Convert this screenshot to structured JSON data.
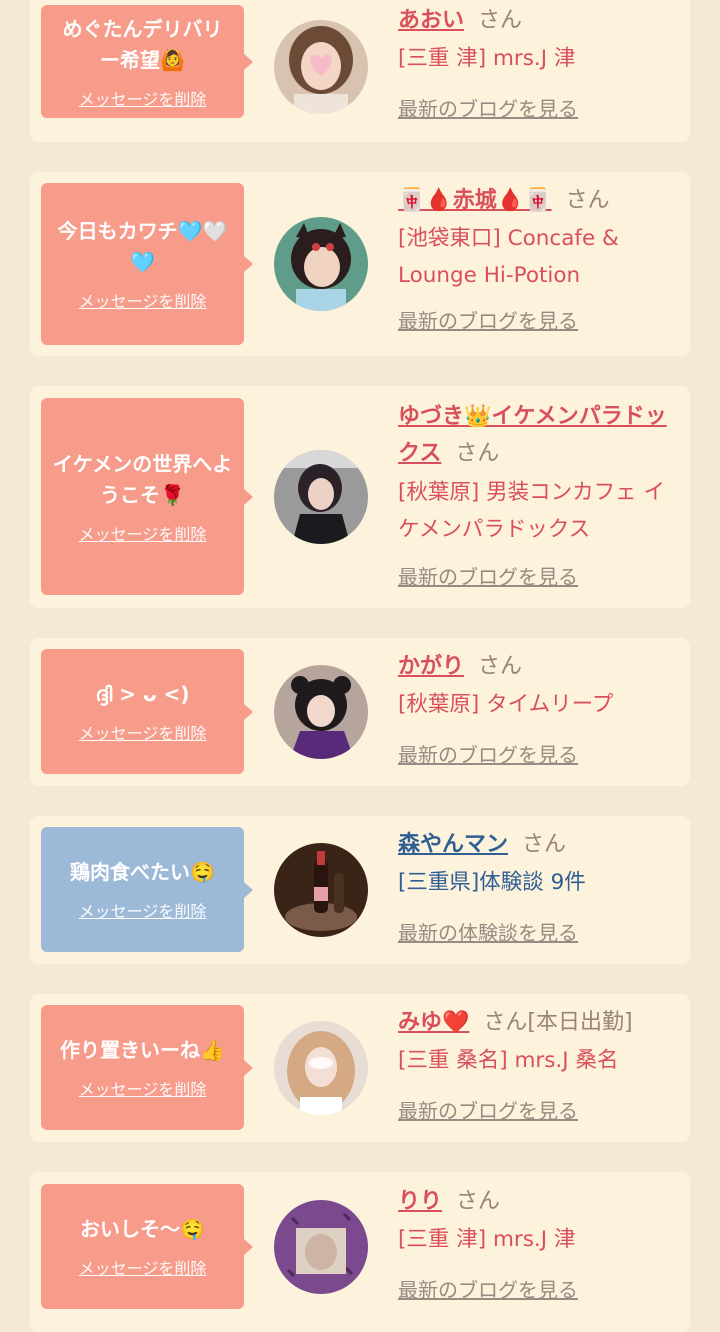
{
  "cards": [
    {
      "bubble_color": "#f79b8a",
      "message": "めぐたんデリバリー希望🙆",
      "delete_label": "メッセージを削除",
      "name": "あおい",
      "suffix": "さん",
      "shop": "[三重 津] mrs.J 津",
      "link": "最新のブログを見る"
    },
    {
      "bubble_color": "#f79b8a",
      "message": "今日もカワチ🩵🤍🩵",
      "delete_label": "メッセージを削除",
      "name": "🀄🩸赤城🩸🀄",
      "suffix": "さん",
      "shop": "[池袋東口] Concafe & Lounge Hi-Potion",
      "link": "最新のブログを見る"
    },
    {
      "bubble_color": "#f79b8a",
      "message": "イケメンの世界へようこそ🌹",
      "delete_label": "メッセージを削除",
      "name": "ゆづき👑イケメンパラドックス",
      "suffix": "さん",
      "shop": "[秋葉原] 男装コンカフェ イケメンパラドックス",
      "link": "最新のブログを見る"
    },
    {
      "bubble_color": "#f79b8a",
      "message": "ദ്ദി > ᴗ <)",
      "delete_label": "メッセージを削除",
      "name": "かがり",
      "suffix": "さん",
      "shop": "[秋葉原] タイムリープ",
      "link": "最新のブログを見る"
    },
    {
      "bubble_color": "#9db9d8",
      "message": "鶏肉食べたい🤤",
      "delete_label": "メッセージを削除",
      "name": "森やんマン",
      "suffix": "さん",
      "shop": "[三重県]体験談 9件",
      "link": "最新の体験談を見る"
    },
    {
      "bubble_color": "#f79b8a",
      "message": "作り置きいーね👍",
      "delete_label": "メッセージを削除",
      "name": "みゆ❤️",
      "suffix": "さん[本日出勤]",
      "shop": "[三重 桑名] mrs.J 桑名",
      "link": "最新のブログを見る"
    },
    {
      "bubble_color": "#f79b8a",
      "message": "おいしそ〜🤤",
      "delete_label": "メッセージを削除",
      "name": "りり",
      "suffix": "さん",
      "shop": "[三重 津] mrs.J 津",
      "link": "最新のブログを見る"
    }
  ]
}
